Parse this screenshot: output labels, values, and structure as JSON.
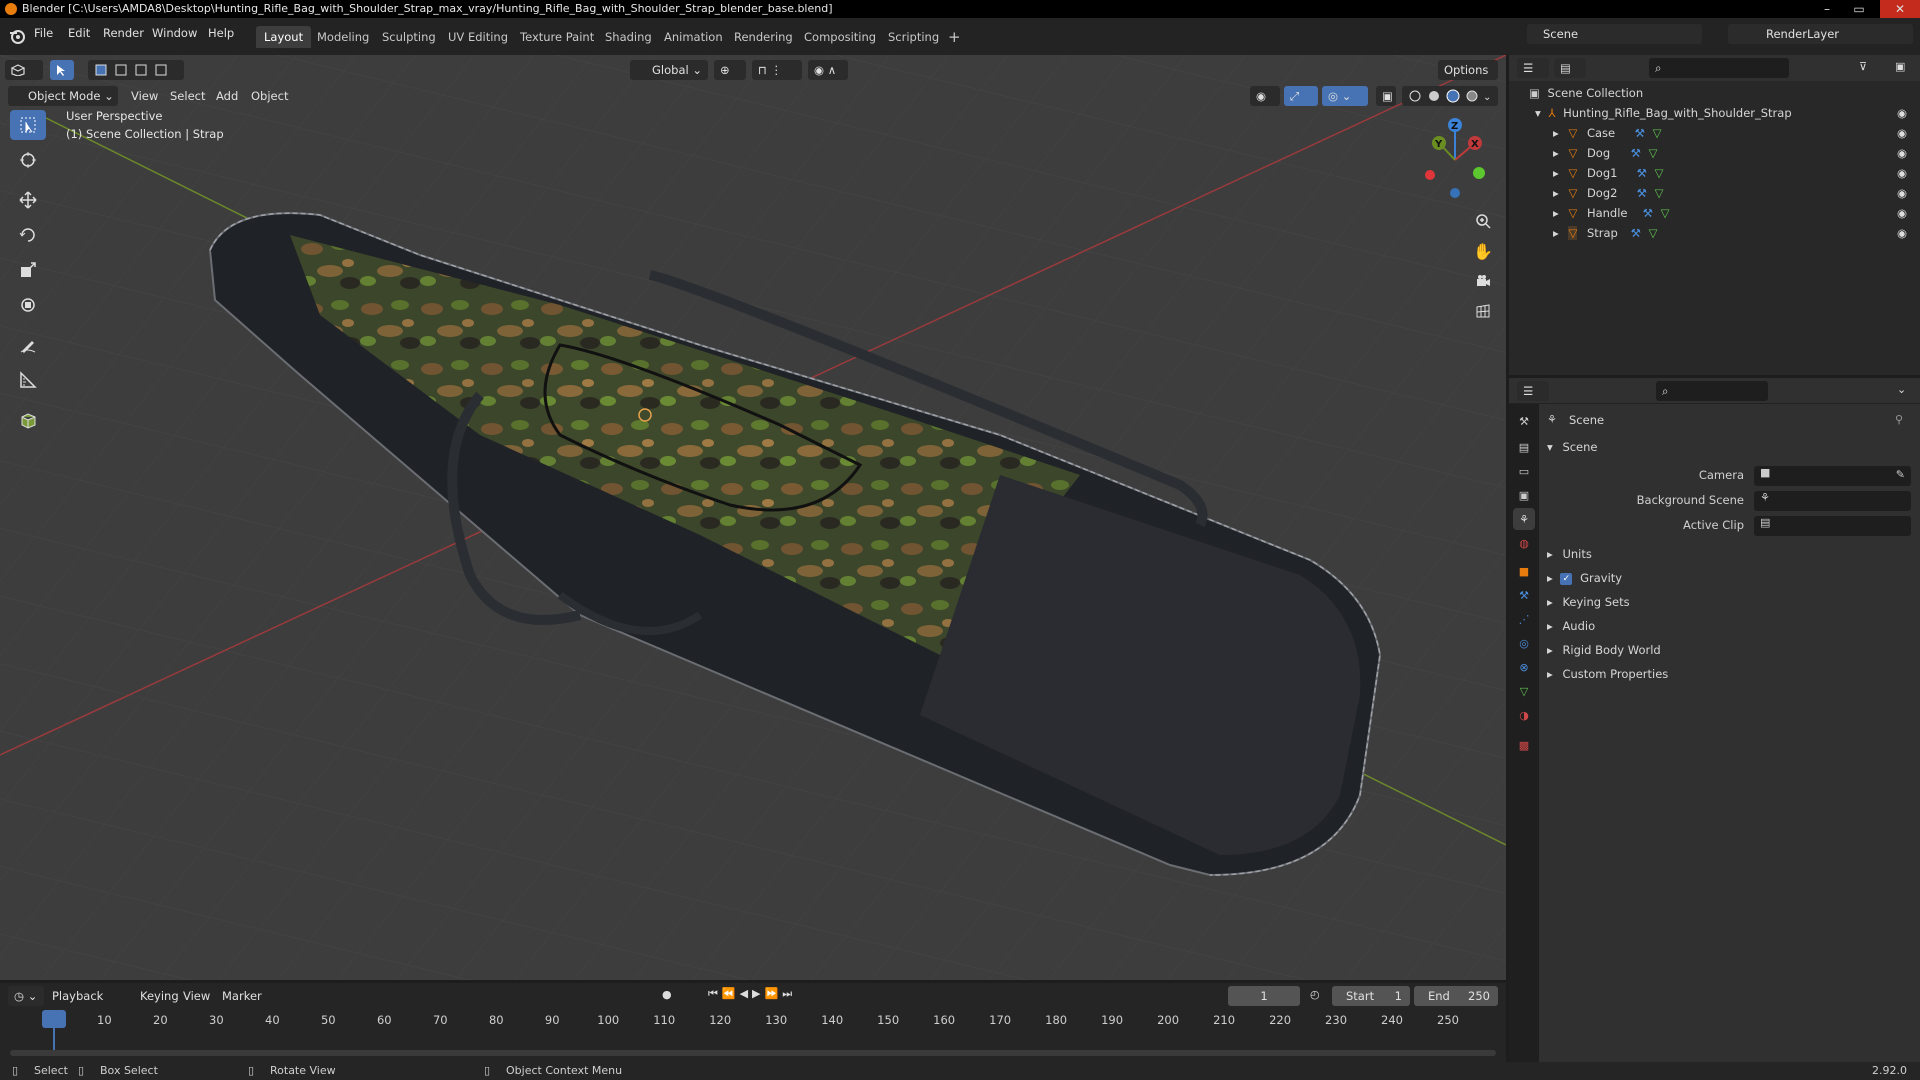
{
  "window": {
    "title": "Blender [C:\\Users\\AMDA8\\Desktop\\Hunting_Rifle_Bag_with_Shoulder_Strap_max_vray/Hunting_Rifle_Bag_with_Shoulder_Strap_blender_base.blend]"
  },
  "menu": {
    "file": "File",
    "edit": "Edit",
    "render": "Render",
    "window": "Window",
    "help": "Help"
  },
  "workspaces": [
    "Layout",
    "Modeling",
    "Sculpting",
    "UV Editing",
    "Texture Paint",
    "Shading",
    "Animation",
    "Rendering",
    "Compositing",
    "Scripting"
  ],
  "scene_selector": {
    "scene": "Scene",
    "view_layer": "RenderLayer"
  },
  "viewport": {
    "mode": "Object Mode",
    "menus": [
      "View",
      "Select",
      "Add",
      "Object"
    ],
    "transform_orientation": "Global",
    "options": "Options",
    "perspective_label": "User Perspective",
    "collection_label": "(1) Scene Collection | Strap",
    "gizmo_axes": {
      "x": "X",
      "y": "Y",
      "z": "Z"
    }
  },
  "outliner": {
    "root": "Scene Collection",
    "collection": "Hunting_Rifle_Bag_with_Shoulder_Strap",
    "objects": [
      "Case",
      "Dog",
      "Dog1",
      "Dog2",
      "Handle",
      "Strap"
    ]
  },
  "properties": {
    "header": "Scene",
    "section": "Scene",
    "camera_label": "Camera",
    "background_label": "Background Scene",
    "clip_label": "Active Clip",
    "panels": [
      "Units",
      "Gravity",
      "Keying Sets",
      "Audio",
      "Rigid Body World",
      "Custom Properties"
    ],
    "gravity_checked": true
  },
  "timeline": {
    "menus": [
      "Playback",
      "Keying",
      "View",
      "Marker"
    ],
    "current_frame": "1",
    "start_label": "Start",
    "start": "1",
    "end_label": "End",
    "end": "250",
    "ticks": [
      "1",
      "10",
      "20",
      "30",
      "40",
      "50",
      "60",
      "70",
      "80",
      "90",
      "100",
      "110",
      "120",
      "130",
      "140",
      "150",
      "160",
      "170",
      "180",
      "190",
      "200",
      "210",
      "220",
      "230",
      "240",
      "250"
    ]
  },
  "statusbar": {
    "select": "Select",
    "box_select": "Box Select",
    "rotate_view": "Rotate View",
    "context_menu": "Object Context Menu",
    "version": "2.92.0"
  },
  "colors": {
    "accent": "#4772b3",
    "viewport_bg": "#3d3d3d",
    "x_axis": "#c0393b",
    "y_axis": "#6b8e23",
    "z_axis": "#3b83d9",
    "object_orange": "#e87d0d"
  }
}
